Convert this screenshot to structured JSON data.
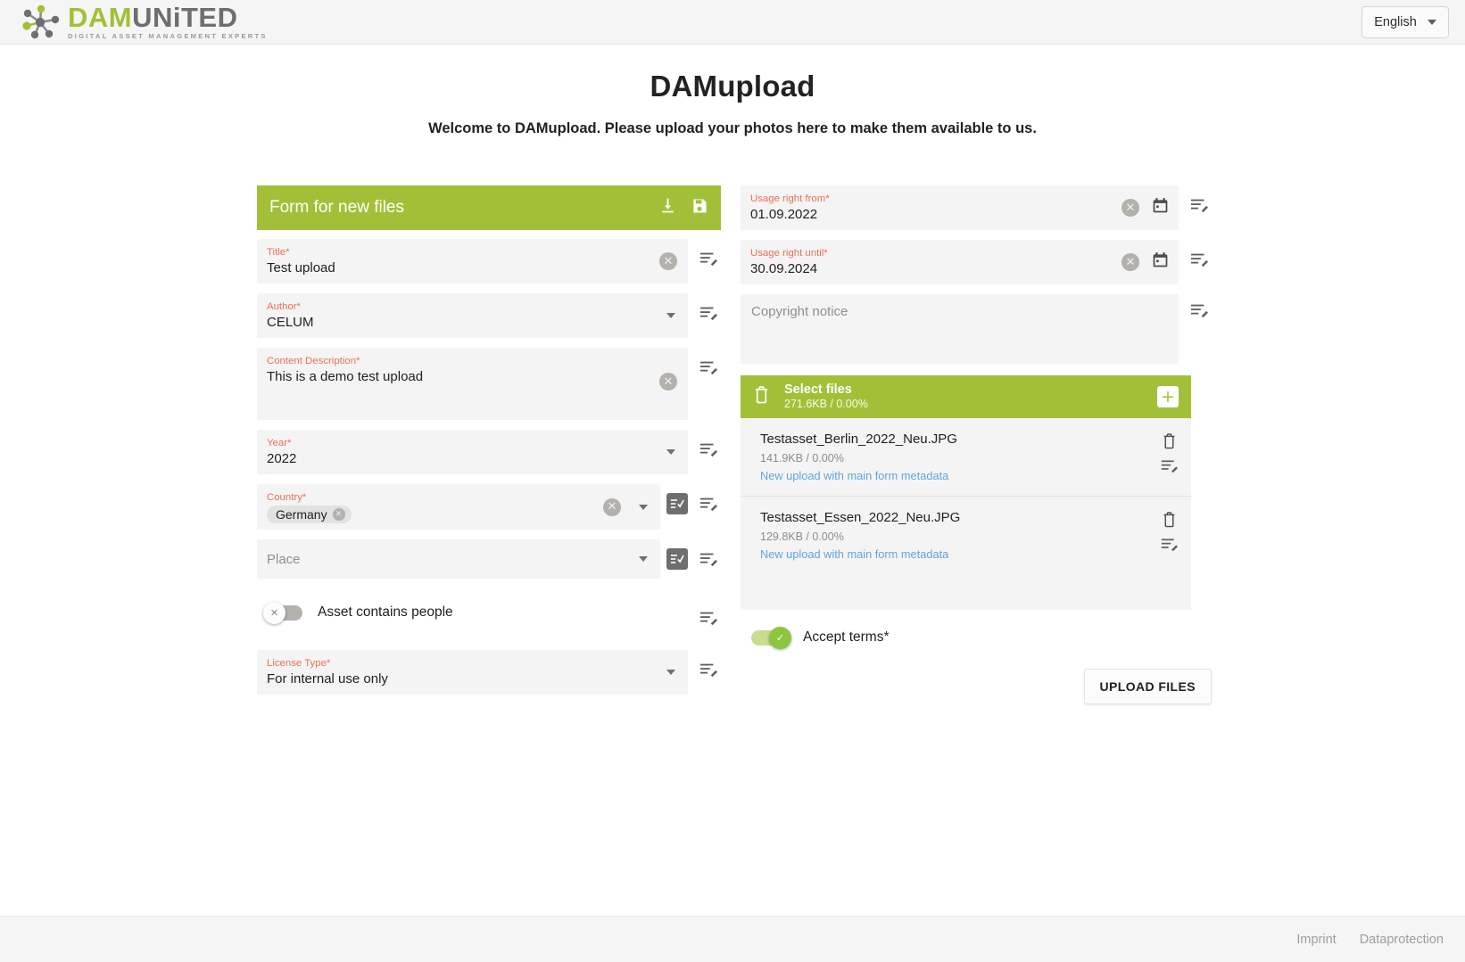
{
  "header": {
    "logo_main_green": "DAM",
    "logo_main_gray": "UNiTED",
    "logo_tagline": "DIGITAL ASSET MANAGEMENT EXPERTS",
    "language": "English"
  },
  "page": {
    "title": "DAMupload",
    "subtitle": "Welcome to DAMupload. Please upload your photos here to make them available to us."
  },
  "form": {
    "header_title": "Form for new files",
    "fields": {
      "title": {
        "label": "Title*",
        "value": "Test upload"
      },
      "author": {
        "label": "Author*",
        "value": "CELUM"
      },
      "content_description": {
        "label": "Content Description*",
        "value": "This is a demo test upload"
      },
      "year": {
        "label": "Year*",
        "value": "2022"
      },
      "country": {
        "label": "Country*",
        "chip": "Germany"
      },
      "place": {
        "label": "Place",
        "placeholder": "Place",
        "value": ""
      },
      "asset_contains_people": {
        "label": "Asset contains people",
        "state": "off"
      },
      "license_type": {
        "label": "License Type*",
        "value": "For internal use only"
      }
    }
  },
  "rights": {
    "usage_from": {
      "label": "Usage right from*",
      "value": "01.09.2022"
    },
    "usage_until": {
      "label": "Usage right until*",
      "value": "30.09.2024"
    },
    "copyright": {
      "placeholder": "Copyright notice",
      "value": ""
    }
  },
  "files_panel": {
    "title": "Select files",
    "summary": "271.6KB / 0.00%",
    "items": [
      {
        "name": "Testasset_Berlin_2022_Neu.JPG",
        "meta": "141.9KB / 0.00%",
        "link": "New upload with main form metadata"
      },
      {
        "name": "Testasset_Essen_2022_Neu.JPG",
        "meta": "129.8KB / 0.00%",
        "link": "New upload with main form metadata"
      }
    ]
  },
  "accept_terms": {
    "label": "Accept terms*",
    "state": "on"
  },
  "upload_button": "UPLOAD FILES",
  "footer": {
    "imprint": "Imprint",
    "dataprotection": "Dataprotection"
  },
  "colors": {
    "brand_green": "#a2c037",
    "label_red": "#e8705a",
    "link_blue": "#60a5dd",
    "toggle_on": "#8cc63e"
  }
}
